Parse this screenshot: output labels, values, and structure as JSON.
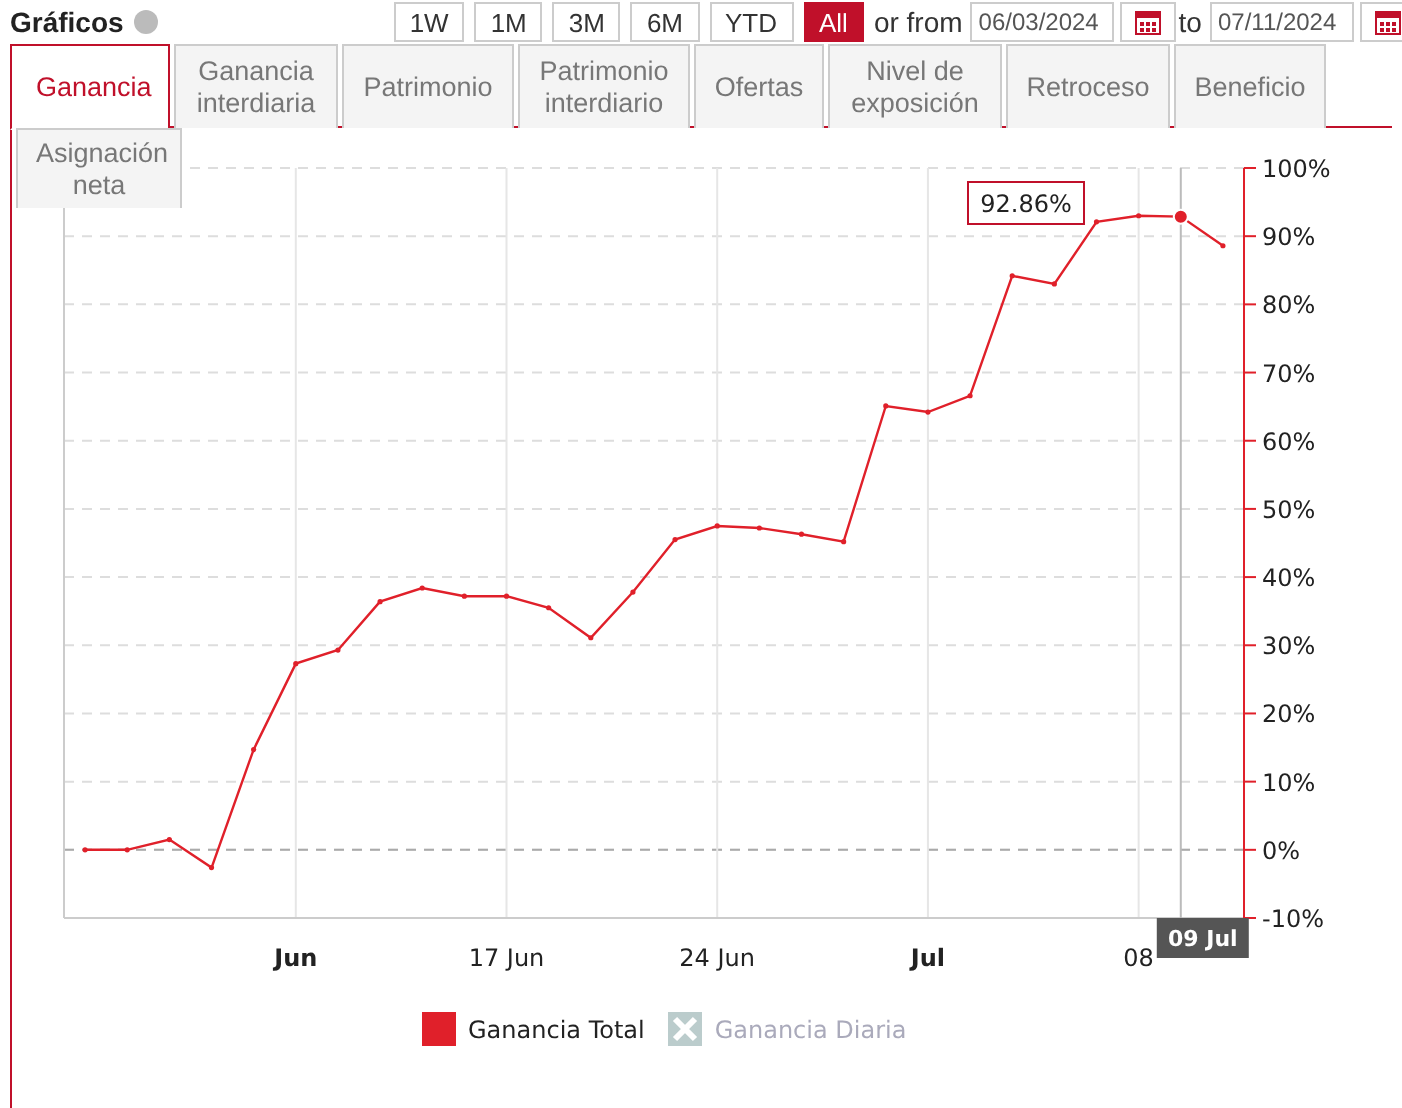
{
  "header": {
    "title": "Gráficos",
    "ranges": [
      {
        "label": "1W",
        "selected": false
      },
      {
        "label": "1M",
        "selected": false
      },
      {
        "label": "3M",
        "selected": false
      },
      {
        "label": "6M",
        "selected": false
      },
      {
        "label": "YTD",
        "selected": false
      },
      {
        "label": "All",
        "selected": true
      }
    ],
    "from_label": "or from",
    "from_date": "06/03/2024",
    "to_label": "to",
    "to_date": "07/11/2024"
  },
  "tabs": [
    [
      {
        "label": "Ganancia",
        "selected": true
      },
      {
        "label": "Ganancia\ninterdiaria",
        "selected": false
      },
      {
        "label": "Patrimonio",
        "selected": false
      },
      {
        "label": "Patrimonio\ninterdiario",
        "selected": false
      },
      {
        "label": "Ofertas",
        "selected": false
      },
      {
        "label": "Nivel de\nexposición",
        "selected": false
      },
      {
        "label": "Retroceso",
        "selected": false
      },
      {
        "label": "Beneficio",
        "selected": false
      }
    ],
    [
      {
        "label": "Asignación\nneta",
        "selected": false
      }
    ]
  ],
  "chart": {
    "chart_data": {
      "type": "line",
      "categories": [
        null,
        null,
        null,
        null,
        null,
        "Jun",
        null,
        null,
        null,
        null,
        "17 Jun",
        null,
        null,
        null,
        null,
        "24 Jun",
        null,
        null,
        null,
        null,
        "Jul",
        null,
        null,
        null,
        null,
        "08",
        null,
        null
      ],
      "series": [
        {
          "name": "Ganancia Total",
          "color": "#e0202a",
          "values": [
            0,
            0,
            1.5,
            -2.6,
            14.7,
            27.3,
            29.3,
            36.4,
            38.4,
            37.2,
            37.2,
            35.5,
            31.1,
            37.8,
            45.5,
            47.5,
            47.2,
            46.3,
            45.2,
            65.1,
            64.2,
            66.6,
            84.2,
            83.0,
            92.1,
            93.0,
            92.86,
            88.6
          ]
        },
        {
          "name": "Ganancia Diaria",
          "color": "#bbcccc",
          "values": [
            null,
            null,
            null,
            null,
            null,
            null,
            null,
            null,
            null,
            null,
            null,
            null,
            null,
            null,
            null,
            null,
            null,
            null,
            null,
            null,
            null,
            null,
            null,
            null,
            null,
            null,
            null,
            null
          ]
        }
      ],
      "ylim": [
        -10,
        100
      ],
      "grid": true,
      "ref_lines": [
        {
          "axis": "y",
          "value": 0
        }
      ],
      "yticks": [
        {
          "value": 100,
          "label": "100%"
        },
        {
          "value": 90,
          "label": "90%"
        },
        {
          "value": 80,
          "label": "80%"
        },
        {
          "value": 70,
          "label": "70%"
        },
        {
          "value": 60,
          "label": "60%"
        },
        {
          "value": 50,
          "label": "50%"
        },
        {
          "value": 40,
          "label": "40%"
        },
        {
          "value": 30,
          "label": "30%"
        },
        {
          "value": 20,
          "label": "20%"
        },
        {
          "value": 10,
          "label": "10%"
        },
        {
          "value": 0,
          "label": "0%"
        },
        {
          "value": -10,
          "label": "-10%"
        }
      ]
    },
    "x_label_bold": [
      true,
      false,
      false,
      true,
      false
    ],
    "hovered": [
      false,
      false,
      false,
      false,
      false,
      false,
      false,
      false,
      false,
      false,
      false,
      false,
      false,
      false,
      false,
      false,
      false,
      false,
      false,
      false,
      false,
      false,
      false,
      false,
      false,
      false,
      true,
      false
    ],
    "tooltip": {
      "value": "92.86%",
      "date": "09 Jul"
    },
    "series_visible": [
      true,
      false
    ]
  }
}
